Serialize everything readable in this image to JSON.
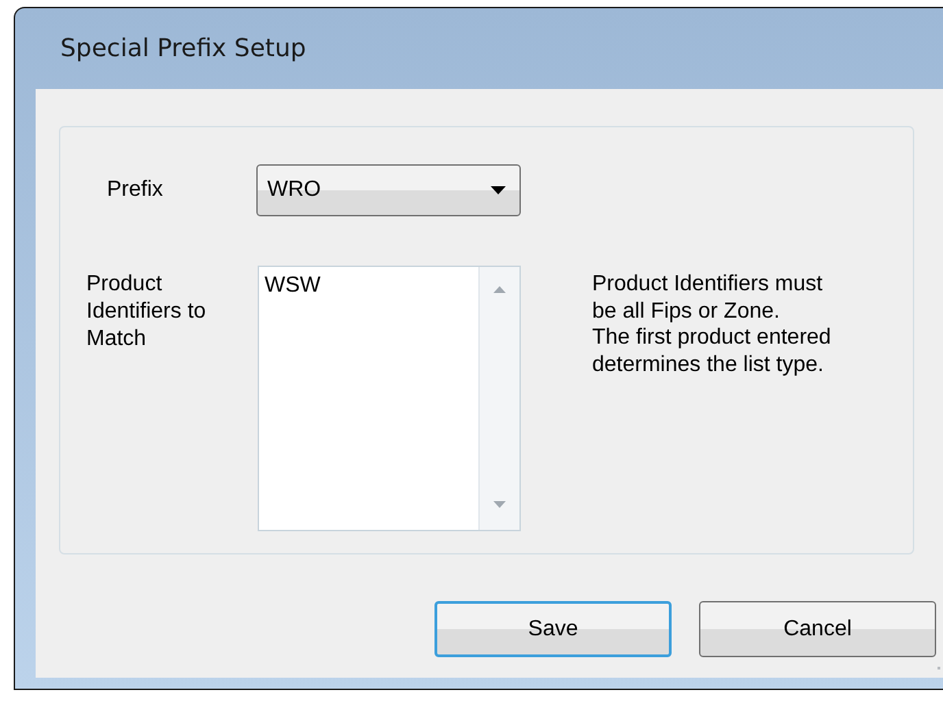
{
  "window": {
    "title": "Special Prefix Setup"
  },
  "prefix": {
    "label": "Prefix",
    "value": "WRO"
  },
  "identifiers": {
    "label": "Product Identifiers to Match",
    "lines": [
      "WSW"
    ]
  },
  "note": [
    "Product Identifiers must be all Fips or Zone.",
    "The first product entered determines the list type."
  ],
  "buttons": [
    {
      "label": "Save",
      "focused": true
    },
    {
      "label": "Cancel",
      "focused": false
    }
  ]
}
